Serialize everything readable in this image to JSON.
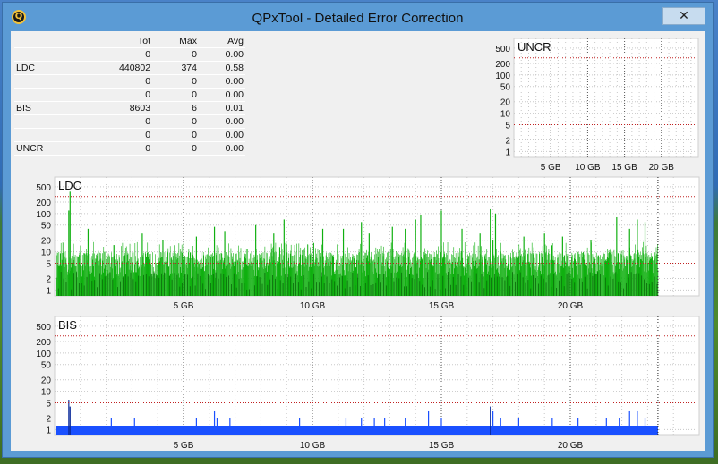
{
  "window": {
    "title": "QPxTool - Detailed Error Correction",
    "close_glyph": "✕",
    "app_icon_glyph": "Q"
  },
  "stats": {
    "headers": [
      "",
      "Tot",
      "Max",
      "Avg"
    ],
    "rows": [
      [
        "",
        "0",
        "0",
        "0.00"
      ],
      [
        "LDC",
        "440802",
        "374",
        "0.58"
      ],
      [
        "",
        "0",
        "0",
        "0.00"
      ],
      [
        "",
        "0",
        "0",
        "0.00"
      ],
      [
        "BIS",
        "8603",
        "6",
        "0.01"
      ],
      [
        "",
        "0",
        "0",
        "0.00"
      ],
      [
        "",
        "0",
        "0",
        "0.00"
      ],
      [
        "UNCR",
        "0",
        "0",
        "0.00"
      ]
    ]
  },
  "colors": {
    "ldc": "#10b010",
    "ldc_dark": "#0a6a0a",
    "bis": "#1a50ff",
    "bis_dark": "#0a2a9a",
    "limit_line": "#c02020"
  },
  "chart_data": [
    {
      "type": "bar",
      "title": "UNCR",
      "y_scale": "log",
      "y_ticks": [
        1,
        2,
        5,
        10,
        20,
        50,
        100,
        200,
        500
      ],
      "x_ticks": [
        "5 GB",
        "10 GB",
        "15 GB",
        "20 GB"
      ],
      "x_tick_values": [
        5,
        10,
        15,
        20
      ],
      "xlim": [
        0,
        25
      ],
      "values": [],
      "limit_lines": [
        280,
        5
      ]
    },
    {
      "type": "bar",
      "title": "LDC",
      "y_scale": "log",
      "y_ticks": [
        1,
        2,
        5,
        10,
        20,
        50,
        100,
        200,
        500
      ],
      "x_ticks": [
        "5 GB",
        "10 GB",
        "15 GB",
        "20 GB"
      ],
      "x_tick_values": [
        5,
        10,
        15,
        20
      ],
      "xlim": [
        0,
        25
      ],
      "data_end": 23.4,
      "baseline_range": [
        2,
        18
      ],
      "spikes": [
        [
          0.6,
          374
        ],
        [
          0.55,
          120
        ],
        [
          1.3,
          40
        ],
        [
          3.4,
          30
        ],
        [
          5.5,
          25
        ],
        [
          6.2,
          45
        ],
        [
          6.6,
          35
        ],
        [
          8.5,
          30
        ],
        [
          10.4,
          40
        ],
        [
          11.2,
          40
        ],
        [
          13.1,
          45
        ],
        [
          13.6,
          40
        ],
        [
          14.0,
          70
        ],
        [
          14.2,
          90
        ],
        [
          15.0,
          120
        ],
        [
          15.8,
          40
        ],
        [
          16.5,
          30
        ],
        [
          17.0,
          20
        ],
        [
          18.2,
          25
        ],
        [
          19.0,
          30
        ],
        [
          20.8,
          20
        ],
        [
          21.8,
          80
        ],
        [
          22.3,
          40
        ],
        [
          22.6,
          70
        ],
        [
          22.9,
          60
        ],
        [
          11.9,
          60
        ],
        [
          8.9,
          70
        ],
        [
          12.2,
          30
        ],
        [
          16.9,
          130
        ],
        [
          17.1,
          100
        ],
        [
          7.8,
          50
        ],
        [
          4.2,
          20
        ],
        [
          2.3,
          15
        ],
        [
          19.7,
          25
        ]
      ],
      "limit_lines": [
        280,
        5
      ]
    },
    {
      "type": "bar",
      "title": "BIS",
      "y_scale": "log",
      "y_ticks": [
        1,
        2,
        5,
        10,
        20,
        50,
        100,
        200,
        500
      ],
      "x_ticks": [
        "5 GB",
        "10 GB",
        "15 GB",
        "20 GB"
      ],
      "x_tick_values": [
        5,
        10,
        15,
        20
      ],
      "xlim": [
        0,
        25
      ],
      "data_end": 23.4,
      "spikes": [
        [
          0.55,
          6
        ],
        [
          0.6,
          4
        ],
        [
          2.2,
          2
        ],
        [
          3.1,
          2
        ],
        [
          5.5,
          2
        ],
        [
          6.2,
          3
        ],
        [
          6.3,
          2
        ],
        [
          6.8,
          2
        ],
        [
          9.5,
          2
        ],
        [
          11.3,
          2
        ],
        [
          11.9,
          2
        ],
        [
          12.4,
          2
        ],
        [
          12.8,
          2
        ],
        [
          13.6,
          2
        ],
        [
          14.5,
          3
        ],
        [
          15.0,
          2
        ],
        [
          16.9,
          4
        ],
        [
          17.0,
          3
        ],
        [
          17.3,
          2
        ],
        [
          18.0,
          2
        ],
        [
          19.3,
          2
        ],
        [
          20.3,
          2
        ],
        [
          21.4,
          2
        ],
        [
          21.9,
          2
        ],
        [
          22.3,
          3
        ],
        [
          22.6,
          3
        ],
        [
          22.9,
          2
        ]
      ],
      "limit_lines": [
        280,
        5
      ]
    }
  ]
}
